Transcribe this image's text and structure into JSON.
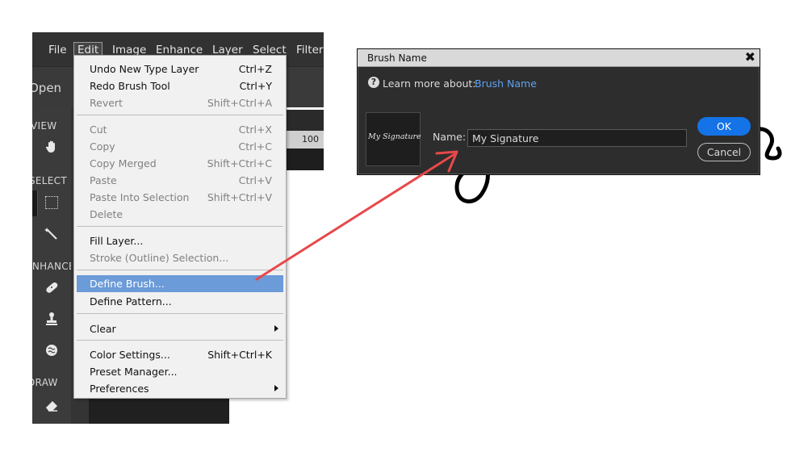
{
  "menubar": {
    "items": [
      "File",
      "Edit",
      "Image",
      "Enhance",
      "Layer",
      "Select",
      "Filter"
    ],
    "active": "Edit"
  },
  "toolbar": {
    "open_label": "Open"
  },
  "tool_sections": [
    "VIEW",
    "SELECT",
    "ENHANCE",
    "DRAW"
  ],
  "ruler": {
    "value": "100"
  },
  "edit_menu": {
    "undo": {
      "label": "Undo New Type Layer",
      "shortcut": "Ctrl+Z"
    },
    "redo": {
      "label": "Redo Brush Tool",
      "shortcut": "Ctrl+Y"
    },
    "revert": {
      "label": "Revert",
      "shortcut": "Shift+Ctrl+A"
    },
    "cut": {
      "label": "Cut",
      "shortcut": "Ctrl+X"
    },
    "copy": {
      "label": "Copy",
      "shortcut": "Ctrl+C"
    },
    "copy_merged": {
      "label": "Copy Merged",
      "shortcut": "Shift+Ctrl+C"
    },
    "paste": {
      "label": "Paste",
      "shortcut": "Ctrl+V"
    },
    "paste_into": {
      "label": "Paste Into Selection",
      "shortcut": "Shift+Ctrl+V"
    },
    "delete": {
      "label": "Delete"
    },
    "fill_layer": {
      "label": "Fill Layer..."
    },
    "stroke": {
      "label": "Stroke (Outline) Selection..."
    },
    "define_brush": {
      "label": "Define Brush..."
    },
    "define_pattern": {
      "label": "Define Pattern..."
    },
    "clear": {
      "label": "Clear"
    },
    "color_settings": {
      "label": "Color Settings...",
      "shortcut": "Shift+Ctrl+K"
    },
    "preset_manager": {
      "label": "Preset Manager..."
    },
    "preferences": {
      "label": "Preferences"
    }
  },
  "dialog": {
    "title": "Brush Name",
    "learn_more": "Learn more about:",
    "learn_link": "Brush Name",
    "preview_text": "My Signature",
    "name_label": "Name:",
    "name_value": "My Signature",
    "ok_label": "OK",
    "cancel_label": "Cancel"
  },
  "colors": {
    "accent": "#1473e6",
    "menu_highlight": "#6b9bd8",
    "arrow": "#e8484a",
    "link": "#5ea2f0"
  }
}
